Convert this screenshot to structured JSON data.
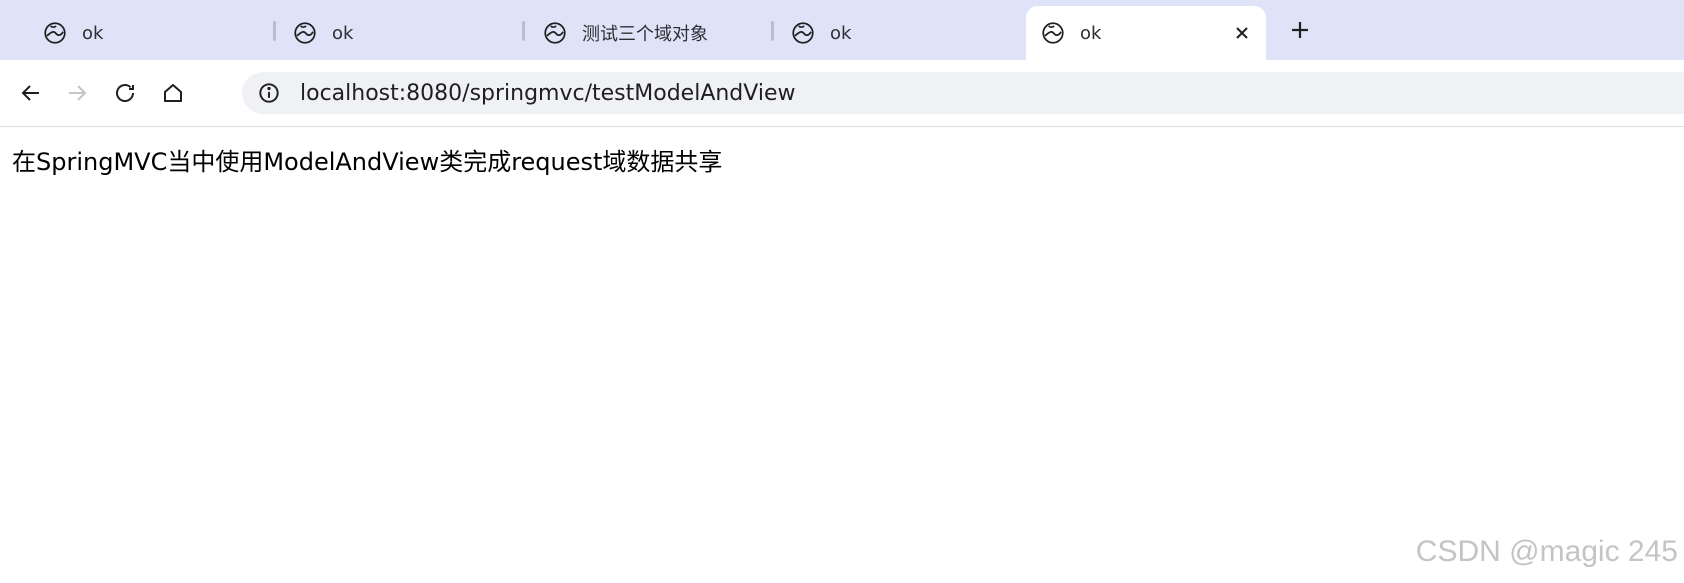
{
  "tabs": [
    {
      "label": "ok",
      "active": false
    },
    {
      "label": "ok",
      "active": false
    },
    {
      "label": "测试三个域对象",
      "active": false
    },
    {
      "label": "ok",
      "active": false
    },
    {
      "label": "ok",
      "active": true
    }
  ],
  "tab_icon": "globe-icon",
  "close_icon": "close-icon",
  "new_tab_icon": "plus-icon",
  "toolbar": {
    "back_icon": "back-arrow-icon",
    "forward_icon": "forward-arrow-icon",
    "reload_icon": "reload-icon",
    "home_icon": "home-icon",
    "site_info_icon": "info-icon",
    "url": "localhost:8080/springmvc/testModelAndView"
  },
  "page": {
    "body_text": "在SpringMVC当中使用ModelAndView类完成request域数据共享"
  },
  "watermark": "CSDN @magic 245",
  "colors": {
    "tabstrip_bg": "#dfe3f7",
    "active_tab_bg": "#ffffff",
    "omnibox_bg": "#eff1f4"
  }
}
